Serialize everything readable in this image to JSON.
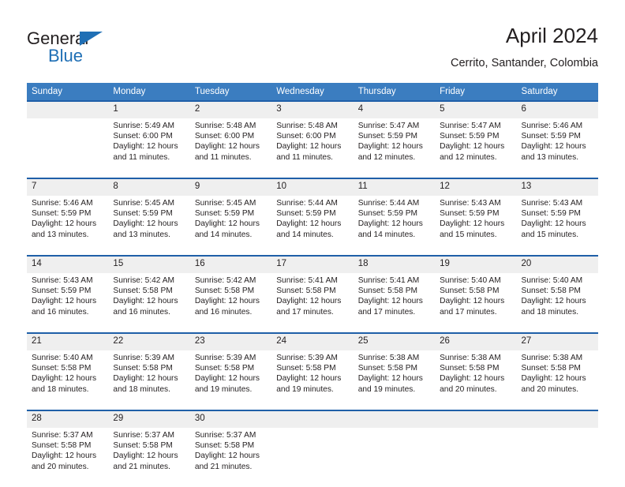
{
  "logo": {
    "word_primary": "General",
    "word_secondary": "Blue",
    "triangle_color": "#1f6fb5",
    "primary_color": "#231f20",
    "secondary_color": "#1f6fb5"
  },
  "header": {
    "title": "April 2024",
    "subtitle": "Cerrito, Santander, Colombia"
  },
  "theme": {
    "header_bg": "#3b7dc0",
    "header_text": "#ffffff",
    "week_separator": "#1f5fa8",
    "daynum_bg": "#efefef",
    "cell_bg": "#ffffff",
    "text": "#231f20"
  },
  "calendar": {
    "weekday_headers": [
      "Sunday",
      "Monday",
      "Tuesday",
      "Wednesday",
      "Thursday",
      "Friday",
      "Saturday"
    ],
    "weeks": [
      [
        {
          "day": "",
          "sunrise": "",
          "sunset": "",
          "daylight_1": "",
          "daylight_2": ""
        },
        {
          "day": "1",
          "sunrise": "Sunrise: 5:49 AM",
          "sunset": "Sunset: 6:00 PM",
          "daylight_1": "Daylight: 12 hours",
          "daylight_2": "and 11 minutes."
        },
        {
          "day": "2",
          "sunrise": "Sunrise: 5:48 AM",
          "sunset": "Sunset: 6:00 PM",
          "daylight_1": "Daylight: 12 hours",
          "daylight_2": "and 11 minutes."
        },
        {
          "day": "3",
          "sunrise": "Sunrise: 5:48 AM",
          "sunset": "Sunset: 6:00 PM",
          "daylight_1": "Daylight: 12 hours",
          "daylight_2": "and 11 minutes."
        },
        {
          "day": "4",
          "sunrise": "Sunrise: 5:47 AM",
          "sunset": "Sunset: 5:59 PM",
          "daylight_1": "Daylight: 12 hours",
          "daylight_2": "and 12 minutes."
        },
        {
          "day": "5",
          "sunrise": "Sunrise: 5:47 AM",
          "sunset": "Sunset: 5:59 PM",
          "daylight_1": "Daylight: 12 hours",
          "daylight_2": "and 12 minutes."
        },
        {
          "day": "6",
          "sunrise": "Sunrise: 5:46 AM",
          "sunset": "Sunset: 5:59 PM",
          "daylight_1": "Daylight: 12 hours",
          "daylight_2": "and 13 minutes."
        }
      ],
      [
        {
          "day": "7",
          "sunrise": "Sunrise: 5:46 AM",
          "sunset": "Sunset: 5:59 PM",
          "daylight_1": "Daylight: 12 hours",
          "daylight_2": "and 13 minutes."
        },
        {
          "day": "8",
          "sunrise": "Sunrise: 5:45 AM",
          "sunset": "Sunset: 5:59 PM",
          "daylight_1": "Daylight: 12 hours",
          "daylight_2": "and 13 minutes."
        },
        {
          "day": "9",
          "sunrise": "Sunrise: 5:45 AM",
          "sunset": "Sunset: 5:59 PM",
          "daylight_1": "Daylight: 12 hours",
          "daylight_2": "and 14 minutes."
        },
        {
          "day": "10",
          "sunrise": "Sunrise: 5:44 AM",
          "sunset": "Sunset: 5:59 PM",
          "daylight_1": "Daylight: 12 hours",
          "daylight_2": "and 14 minutes."
        },
        {
          "day": "11",
          "sunrise": "Sunrise: 5:44 AM",
          "sunset": "Sunset: 5:59 PM",
          "daylight_1": "Daylight: 12 hours",
          "daylight_2": "and 14 minutes."
        },
        {
          "day": "12",
          "sunrise": "Sunrise: 5:43 AM",
          "sunset": "Sunset: 5:59 PM",
          "daylight_1": "Daylight: 12 hours",
          "daylight_2": "and 15 minutes."
        },
        {
          "day": "13",
          "sunrise": "Sunrise: 5:43 AM",
          "sunset": "Sunset: 5:59 PM",
          "daylight_1": "Daylight: 12 hours",
          "daylight_2": "and 15 minutes."
        }
      ],
      [
        {
          "day": "14",
          "sunrise": "Sunrise: 5:43 AM",
          "sunset": "Sunset: 5:59 PM",
          "daylight_1": "Daylight: 12 hours",
          "daylight_2": "and 16 minutes."
        },
        {
          "day": "15",
          "sunrise": "Sunrise: 5:42 AM",
          "sunset": "Sunset: 5:58 PM",
          "daylight_1": "Daylight: 12 hours",
          "daylight_2": "and 16 minutes."
        },
        {
          "day": "16",
          "sunrise": "Sunrise: 5:42 AM",
          "sunset": "Sunset: 5:58 PM",
          "daylight_1": "Daylight: 12 hours",
          "daylight_2": "and 16 minutes."
        },
        {
          "day": "17",
          "sunrise": "Sunrise: 5:41 AM",
          "sunset": "Sunset: 5:58 PM",
          "daylight_1": "Daylight: 12 hours",
          "daylight_2": "and 17 minutes."
        },
        {
          "day": "18",
          "sunrise": "Sunrise: 5:41 AM",
          "sunset": "Sunset: 5:58 PM",
          "daylight_1": "Daylight: 12 hours",
          "daylight_2": "and 17 minutes."
        },
        {
          "day": "19",
          "sunrise": "Sunrise: 5:40 AM",
          "sunset": "Sunset: 5:58 PM",
          "daylight_1": "Daylight: 12 hours",
          "daylight_2": "and 17 minutes."
        },
        {
          "day": "20",
          "sunrise": "Sunrise: 5:40 AM",
          "sunset": "Sunset: 5:58 PM",
          "daylight_1": "Daylight: 12 hours",
          "daylight_2": "and 18 minutes."
        }
      ],
      [
        {
          "day": "21",
          "sunrise": "Sunrise: 5:40 AM",
          "sunset": "Sunset: 5:58 PM",
          "daylight_1": "Daylight: 12 hours",
          "daylight_2": "and 18 minutes."
        },
        {
          "day": "22",
          "sunrise": "Sunrise: 5:39 AM",
          "sunset": "Sunset: 5:58 PM",
          "daylight_1": "Daylight: 12 hours",
          "daylight_2": "and 18 minutes."
        },
        {
          "day": "23",
          "sunrise": "Sunrise: 5:39 AM",
          "sunset": "Sunset: 5:58 PM",
          "daylight_1": "Daylight: 12 hours",
          "daylight_2": "and 19 minutes."
        },
        {
          "day": "24",
          "sunrise": "Sunrise: 5:39 AM",
          "sunset": "Sunset: 5:58 PM",
          "daylight_1": "Daylight: 12 hours",
          "daylight_2": "and 19 minutes."
        },
        {
          "day": "25",
          "sunrise": "Sunrise: 5:38 AM",
          "sunset": "Sunset: 5:58 PM",
          "daylight_1": "Daylight: 12 hours",
          "daylight_2": "and 19 minutes."
        },
        {
          "day": "26",
          "sunrise": "Sunrise: 5:38 AM",
          "sunset": "Sunset: 5:58 PM",
          "daylight_1": "Daylight: 12 hours",
          "daylight_2": "and 20 minutes."
        },
        {
          "day": "27",
          "sunrise": "Sunrise: 5:38 AM",
          "sunset": "Sunset: 5:58 PM",
          "daylight_1": "Daylight: 12 hours",
          "daylight_2": "and 20 minutes."
        }
      ],
      [
        {
          "day": "28",
          "sunrise": "Sunrise: 5:37 AM",
          "sunset": "Sunset: 5:58 PM",
          "daylight_1": "Daylight: 12 hours",
          "daylight_2": "and 20 minutes."
        },
        {
          "day": "29",
          "sunrise": "Sunrise: 5:37 AM",
          "sunset": "Sunset: 5:58 PM",
          "daylight_1": "Daylight: 12 hours",
          "daylight_2": "and 21 minutes."
        },
        {
          "day": "30",
          "sunrise": "Sunrise: 5:37 AM",
          "sunset": "Sunset: 5:58 PM",
          "daylight_1": "Daylight: 12 hours",
          "daylight_2": "and 21 minutes."
        },
        {
          "day": "",
          "sunrise": "",
          "sunset": "",
          "daylight_1": "",
          "daylight_2": ""
        },
        {
          "day": "",
          "sunrise": "",
          "sunset": "",
          "daylight_1": "",
          "daylight_2": ""
        },
        {
          "day": "",
          "sunrise": "",
          "sunset": "",
          "daylight_1": "",
          "daylight_2": ""
        },
        {
          "day": "",
          "sunrise": "",
          "sunset": "",
          "daylight_1": "",
          "daylight_2": ""
        }
      ]
    ]
  }
}
